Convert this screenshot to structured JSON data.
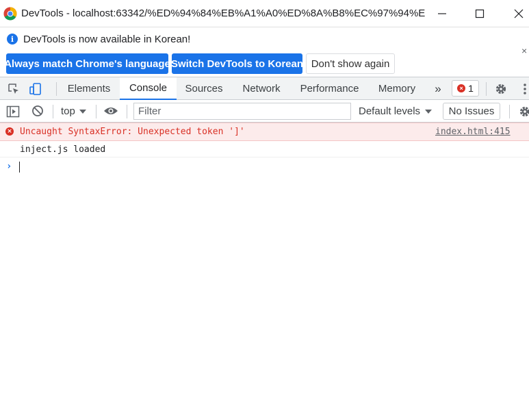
{
  "window": {
    "title": "DevTools - localhost:63342/%ED%94%84%EB%A1%A0%ED%8A%B8%EC%97%94%E...",
    "icons": {
      "app": "chrome-logo",
      "minimize": "minimize-icon",
      "maximize": "maximize-icon",
      "close": "close-icon"
    }
  },
  "infobar": {
    "message": "DevTools is now available in Korean!",
    "buttons": {
      "match_language": "Always match Chrome's language",
      "switch_korean": "Switch DevTools to Korean",
      "dont_show": "Don't show again"
    },
    "close_glyph": "×"
  },
  "tabs": {
    "items": [
      "Elements",
      "Console",
      "Sources",
      "Network",
      "Performance",
      "Memory"
    ],
    "active": "Console",
    "overflow_glyph": "»",
    "error_count": "1"
  },
  "console_toolbar": {
    "context": "top",
    "filter_placeholder": "Filter",
    "levels": "Default levels",
    "issues": "No Issues"
  },
  "messages": {
    "error": {
      "text": "Uncaught SyntaxError: Unexpected token ']'",
      "source": "index.html:415"
    },
    "log": {
      "text": "inject.js loaded"
    },
    "prompt_glyph": "›"
  },
  "colors": {
    "accent": "#1a73e8",
    "error": "#d93025",
    "error_bg": "#fcebeb",
    "toolbar_bg": "#f1f3f4"
  }
}
